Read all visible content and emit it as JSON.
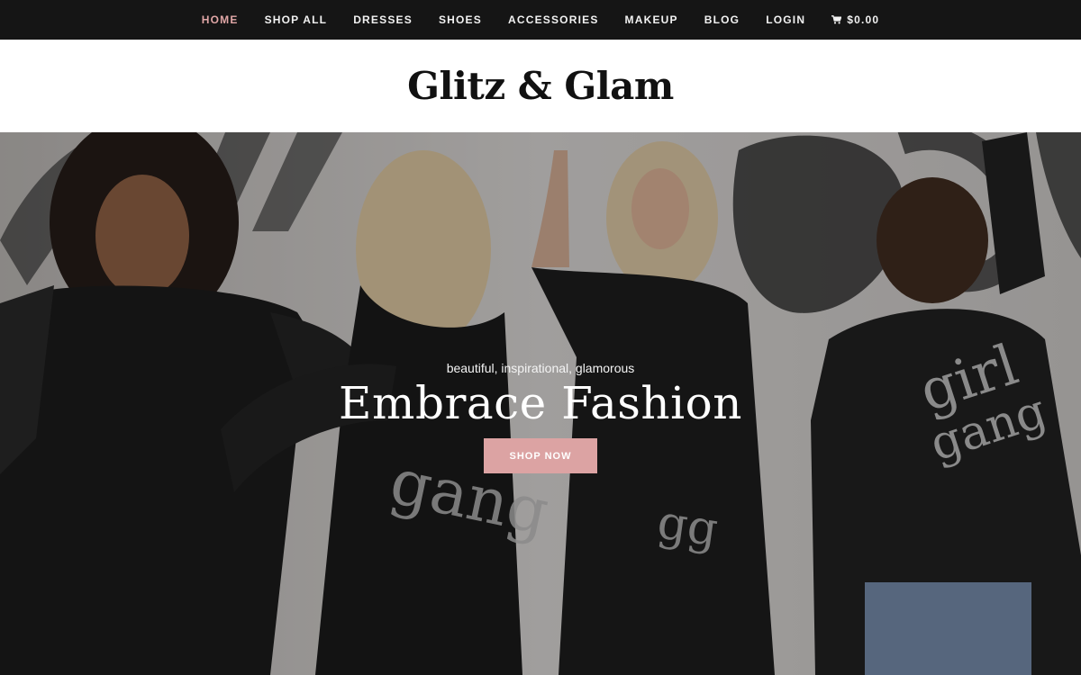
{
  "nav": {
    "items": [
      {
        "label": "HOME",
        "active": true
      },
      {
        "label": "SHOP ALL"
      },
      {
        "label": "DRESSES"
      },
      {
        "label": "SHOES"
      },
      {
        "label": "ACCESSORIES"
      },
      {
        "label": "MAKEUP"
      },
      {
        "label": "BLOG"
      },
      {
        "label": "LOGIN"
      }
    ],
    "cart_total": "$0.00",
    "cart_icon": "shopping-cart-icon"
  },
  "header": {
    "site_title": "Glitz & Glam"
  },
  "hero": {
    "tagline": "beautiful, inspirational, glamorous",
    "heading": "Embrace Fashion",
    "button_label": "SHOP NOW"
  },
  "colors": {
    "nav_bg": "#151515",
    "nav_active": "#e0a6a6",
    "button_bg": "#dca3a3"
  }
}
